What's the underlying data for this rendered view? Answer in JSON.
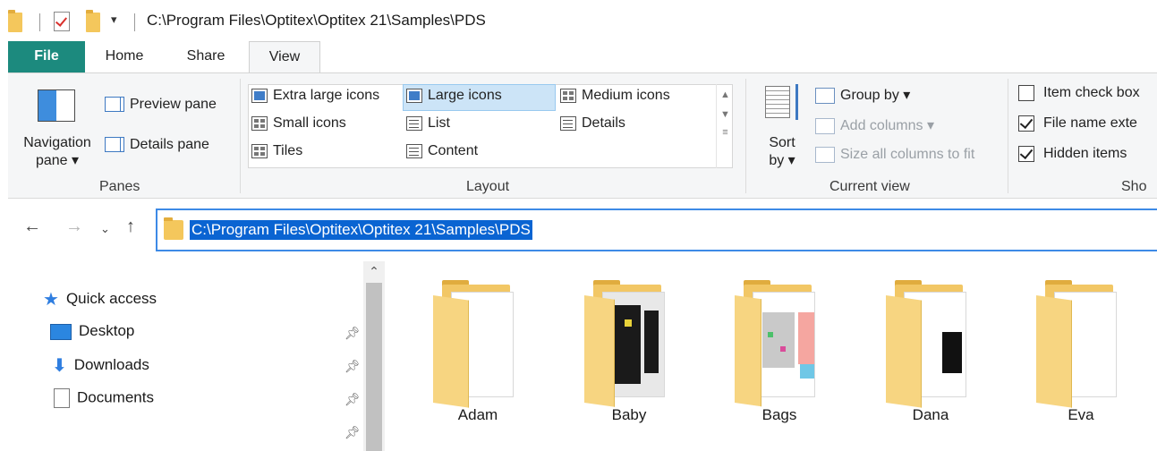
{
  "window": {
    "title_path": "C:\\Program Files\\Optitex\\Optitex 21\\Samples\\PDS",
    "quick_access_dropdown": "▾"
  },
  "tabs": {
    "file": "File",
    "home": "Home",
    "share": "Share",
    "view": "View"
  },
  "ribbon": {
    "panes": {
      "navigation_pane": "Navigation pane ▾",
      "preview_pane": "Preview pane",
      "details_pane": "Details pane",
      "group_label": "Panes"
    },
    "layout": {
      "extra_large_icons": "Extra large icons",
      "large_icons": "Large icons",
      "medium_icons": "Medium icons",
      "small_icons": "Small icons",
      "list": "List",
      "details": "Details",
      "tiles": "Tiles",
      "content": "Content",
      "group_label": "Layout",
      "selected": "Large icons"
    },
    "current_view": {
      "sort_by": "Sort by ▾",
      "group_by": "Group by ▾",
      "add_columns": "Add columns ▾",
      "size_all_columns": "Size all columns to fit",
      "group_label": "Current view"
    },
    "show_hide": {
      "item_check_boxes": "Item check box",
      "file_name_extensions": "File name exte",
      "hidden_items": "Hidden items",
      "group_label": "Sho",
      "item_check_boxes_checked": false,
      "file_name_extensions_checked": true,
      "hidden_items_checked": true
    }
  },
  "address_bar": {
    "path": "C:\\Program Files\\Optitex\\Optitex 21\\Samples\\PDS"
  },
  "nav_pane": {
    "quick_access": "Quick access",
    "items": [
      {
        "label": "Desktop",
        "icon": "desktop-icon"
      },
      {
        "label": "Downloads",
        "icon": "downloads-icon"
      },
      {
        "label": "Documents",
        "icon": "documents-icon"
      }
    ]
  },
  "folders": [
    {
      "name": "Adam"
    },
    {
      "name": "Baby"
    },
    {
      "name": "Bags"
    },
    {
      "name": "Dana"
    },
    {
      "name": "Eva"
    }
  ],
  "colors": {
    "file_tab": "#1c8a7e",
    "selection": "#cce4f7",
    "address_highlight": "#0a64d2",
    "folder": "#f2c765"
  }
}
